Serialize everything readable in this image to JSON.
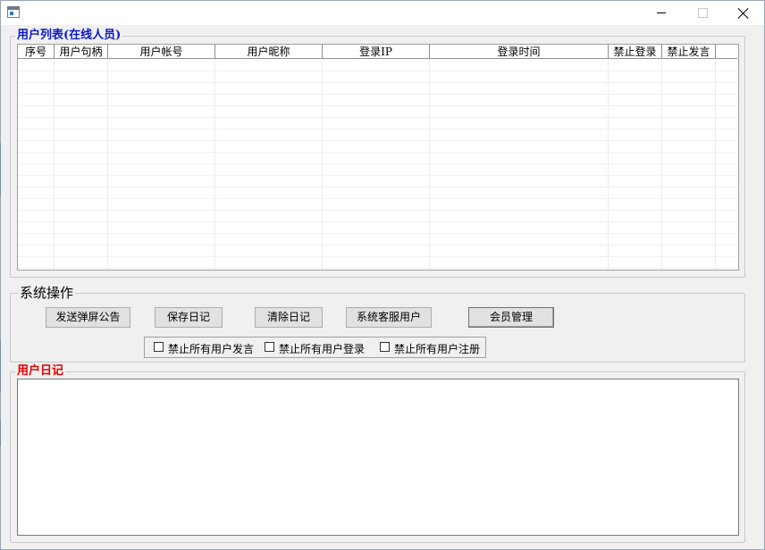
{
  "window": {
    "title": "",
    "minimize_icon": "minimize-icon",
    "maximize_icon": "maximize-icon",
    "close_icon": "close-icon"
  },
  "user_list": {
    "legend": "用户列表(在线人员)",
    "columns": [
      "序号",
      "用户句柄",
      "用户帐号",
      "用户昵称",
      "登录IP",
      "登录时间",
      "禁止登录",
      "禁止发言"
    ],
    "rows": []
  },
  "system_ops": {
    "legend": "系统操作",
    "buttons": {
      "send_popup": "发送弹屏公告",
      "save_log": "保存日记",
      "clear_log": "清除日记",
      "customer_service": "系统客服用户",
      "member_manage": "会员管理"
    },
    "checkboxes": {
      "ban_speak_all": {
        "label": "禁止所有用户发言",
        "checked": false
      },
      "ban_login_all": {
        "label": "禁止所有用户登录",
        "checked": false
      },
      "ban_register_all": {
        "label": "禁止所有用户注册",
        "checked": false
      }
    }
  },
  "user_log": {
    "legend": "用户日记",
    "content": ""
  },
  "colors": {
    "legend_blue": "#0b18c7",
    "legend_red": "#e00000"
  }
}
